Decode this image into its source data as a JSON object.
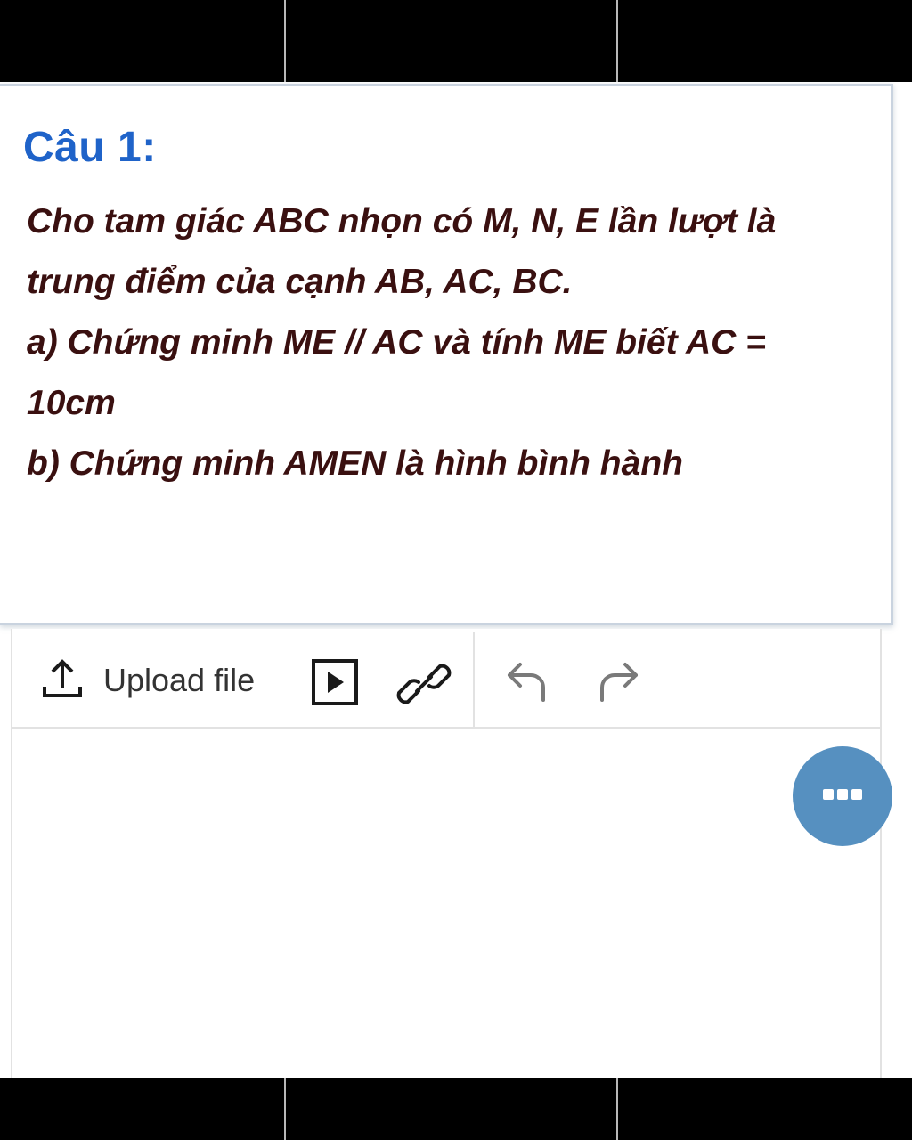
{
  "question": {
    "title": "Câu 1:",
    "lines": [
      "Cho tam giác ABC nhọn có M, N, E lần lượt là",
      "trung điểm của cạnh AB, AC, BC.",
      "a) Chứng minh ME // AC và tính ME biết AC =",
      "10cm",
      "b) Chứng minh AMEN là hình bình hành"
    ]
  },
  "toolbar": {
    "upload_label": "Upload file",
    "icons": [
      "upload-icon",
      "video-icon",
      "link-icon",
      "undo-icon",
      "redo-icon"
    ]
  },
  "more_button": {
    "icon": "more-dots-icon"
  },
  "colors": {
    "title": "#1f63c9",
    "body_text": "#3a1010",
    "more_button": "#5690c0"
  }
}
